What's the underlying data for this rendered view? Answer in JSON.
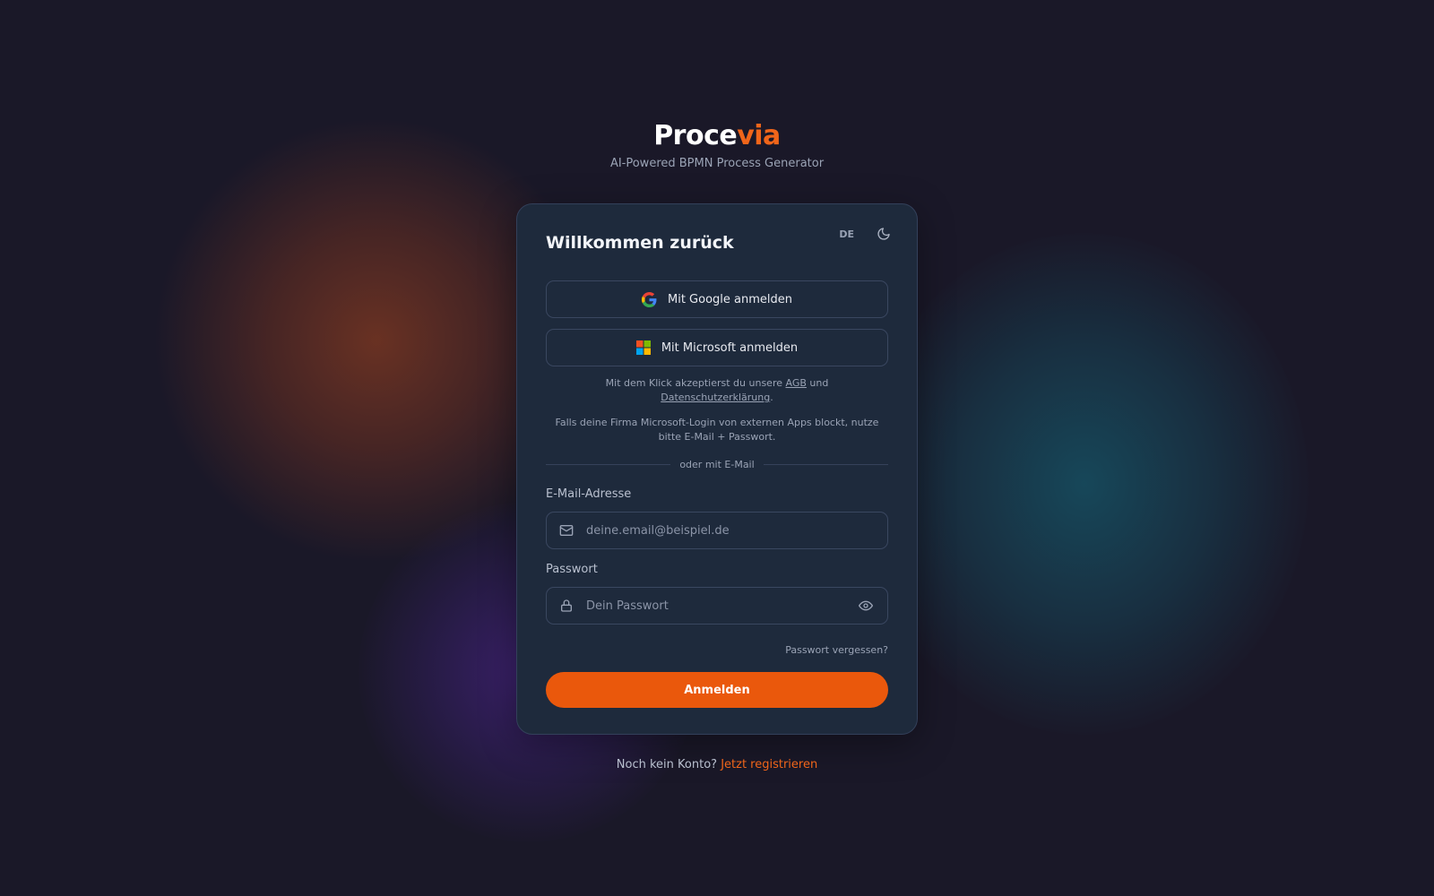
{
  "brand": {
    "logo_part1": "Proce",
    "logo_part2": "via",
    "tagline": "AI-Powered BPMN Process Generator",
    "accent_color": "#ea580c"
  },
  "card": {
    "title": "Willkommen zurück",
    "language": "DE",
    "theme_icon": "moon-icon"
  },
  "sso": {
    "google_label": "Mit Google anmelden",
    "microsoft_label": "Mit Microsoft anmelden"
  },
  "legal": {
    "prefix": "Mit dem Klick akzeptierst du unsere",
    "agb": "AGB",
    "and": "und",
    "privacy": "Datenschutzerklärung",
    "suffix": "."
  },
  "firm_note": "Falls deine Firma Microsoft-Login von externen Apps blockt, nutze bitte E-Mail + Passwort.",
  "divider": "oder mit E-Mail",
  "form": {
    "email_label": "E-Mail-Adresse",
    "email_placeholder": "deine.email@beispiel.de",
    "email_value": "",
    "password_label": "Passwort",
    "password_placeholder": "Dein Passwort",
    "password_value": "",
    "forgot": "Passwort vergessen?",
    "submit": "Anmelden"
  },
  "signup": {
    "text": "Noch kein Konto?",
    "link": "Jetzt registrieren"
  }
}
